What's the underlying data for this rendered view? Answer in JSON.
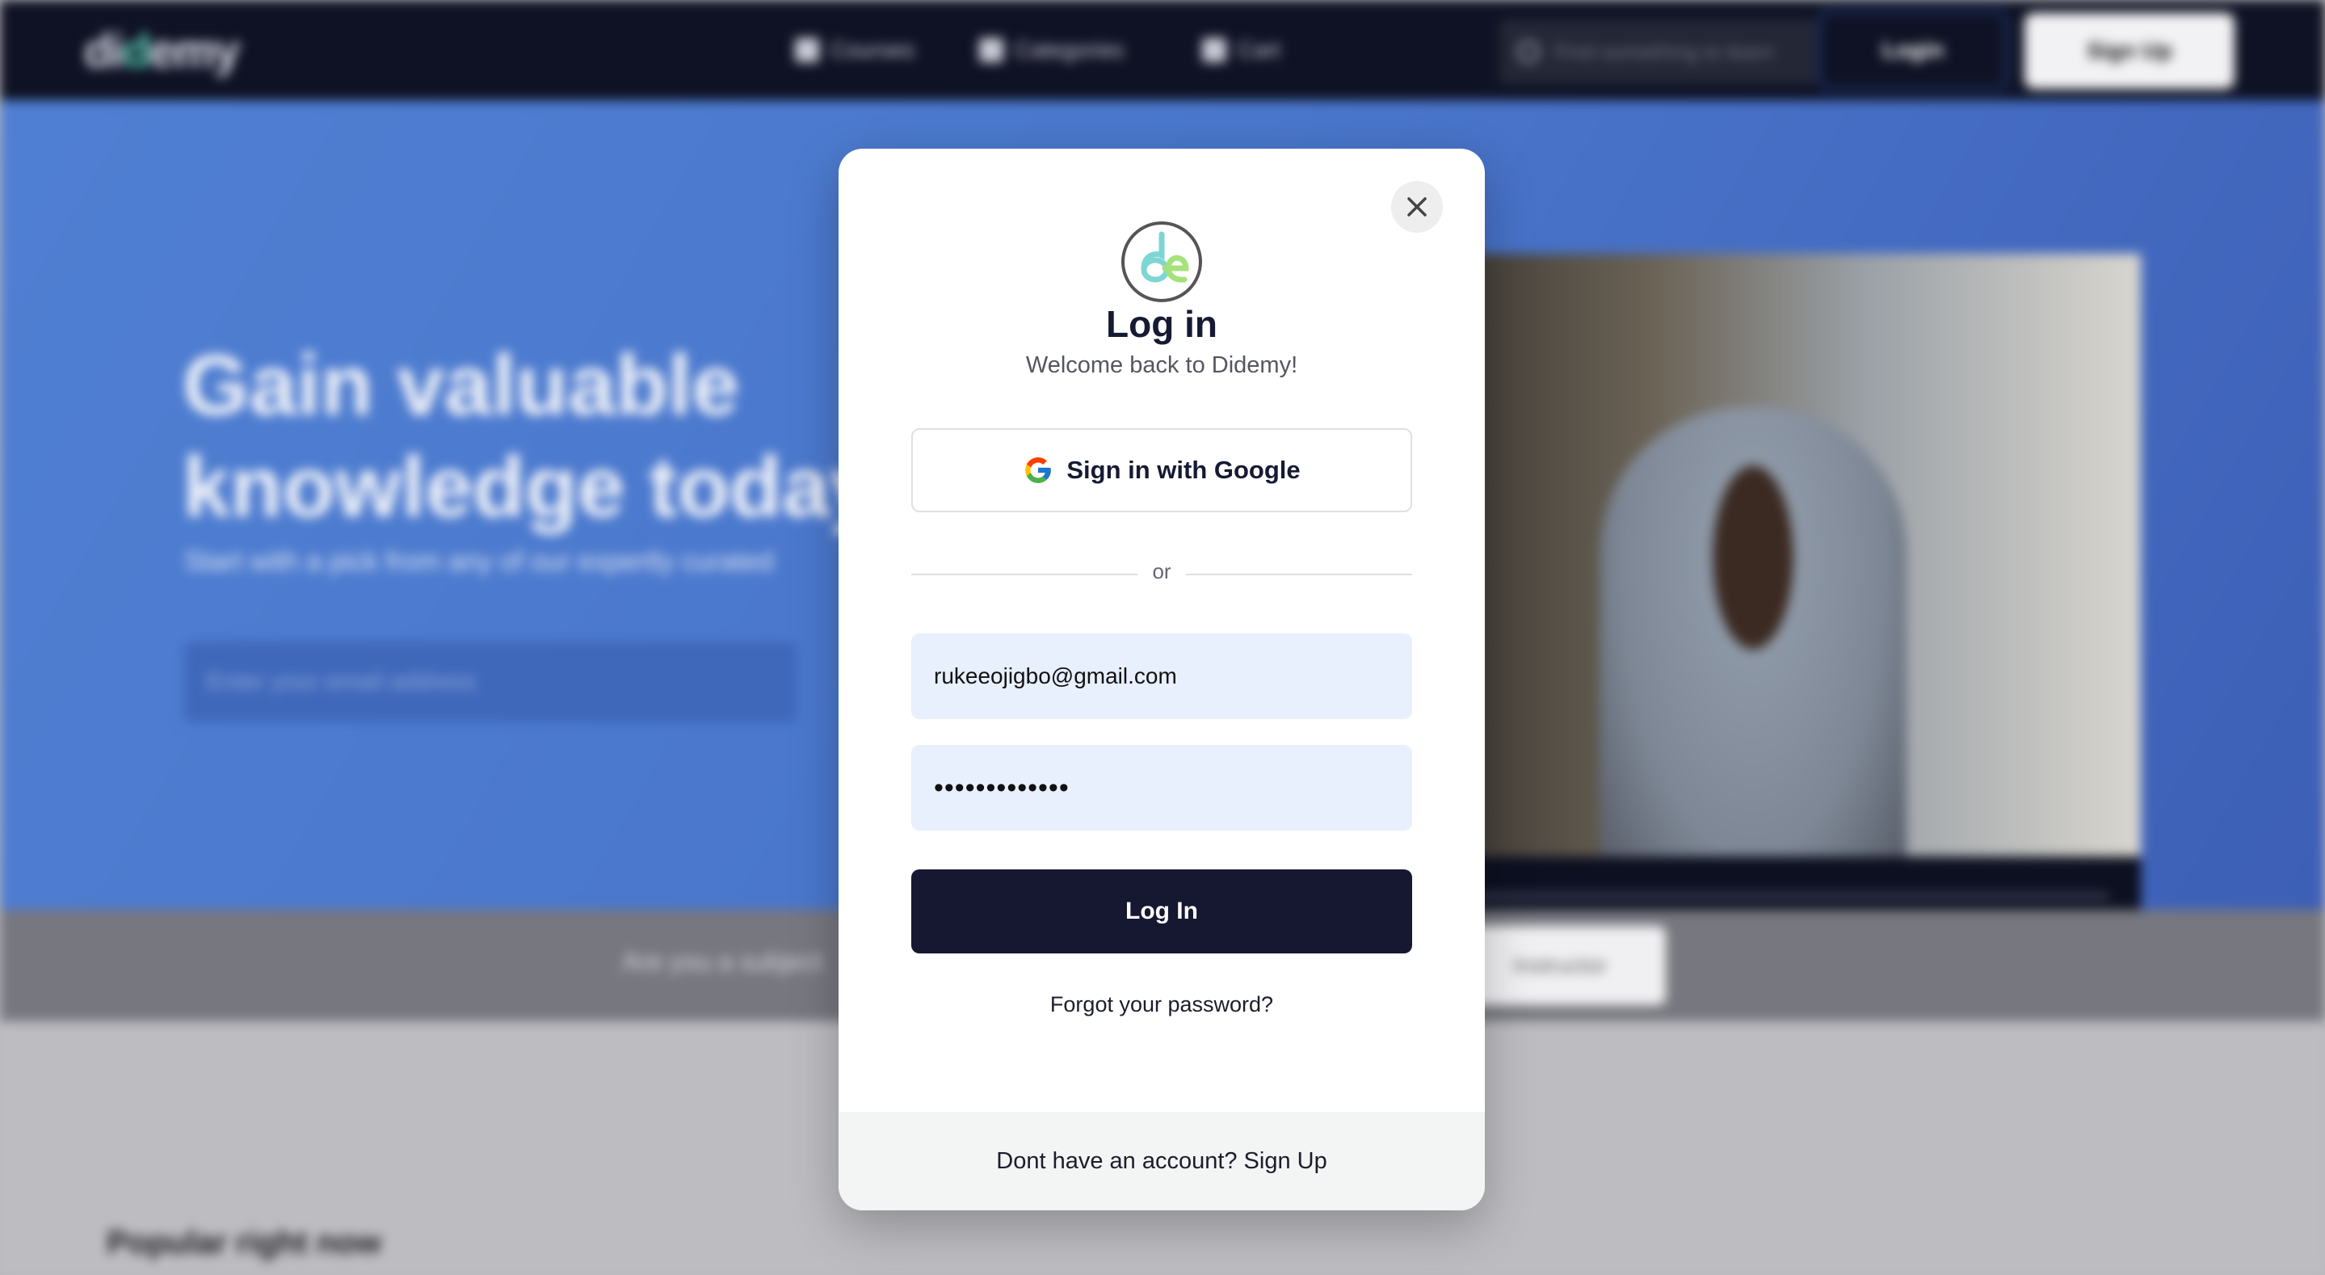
{
  "nav": {
    "logo_text": "didemy",
    "links": [
      {
        "label": "Courses",
        "icon": "book-icon"
      },
      {
        "label": "Categories",
        "icon": "grid-icon"
      },
      {
        "label": "Cart",
        "icon": "cart-icon"
      }
    ],
    "search_placeholder": "Find something to learn",
    "login_label": "Login",
    "signup_label": "Sign Up"
  },
  "hero": {
    "title": "Gain valuable knowledge today",
    "subtitle": "Start with a pick from any of our expertly curated",
    "email_placeholder": "Enter your email address"
  },
  "instructor_band": {
    "text": "Are you a subject",
    "button_label": "Instructor"
  },
  "section_popular": "Popular right now",
  "modal": {
    "title": "Log in",
    "subtitle": "Welcome back to Didemy!",
    "google_label": "Sign in with Google",
    "divider_text": "or",
    "email_value": "rukeeojigbo@gmail.com",
    "password_value": "•••••••••••••",
    "login_button": "Log In",
    "forgot_password": "Forgot your password?",
    "footer_text": "Dont have an account?",
    "footer_link": "Sign Up"
  },
  "colors": {
    "nav_bg": "#0f1224",
    "hero_bg": "#4a77cc",
    "primary_button": "#161731",
    "input_bg": "#e8effd",
    "brand_accent": "#58c9b0"
  }
}
